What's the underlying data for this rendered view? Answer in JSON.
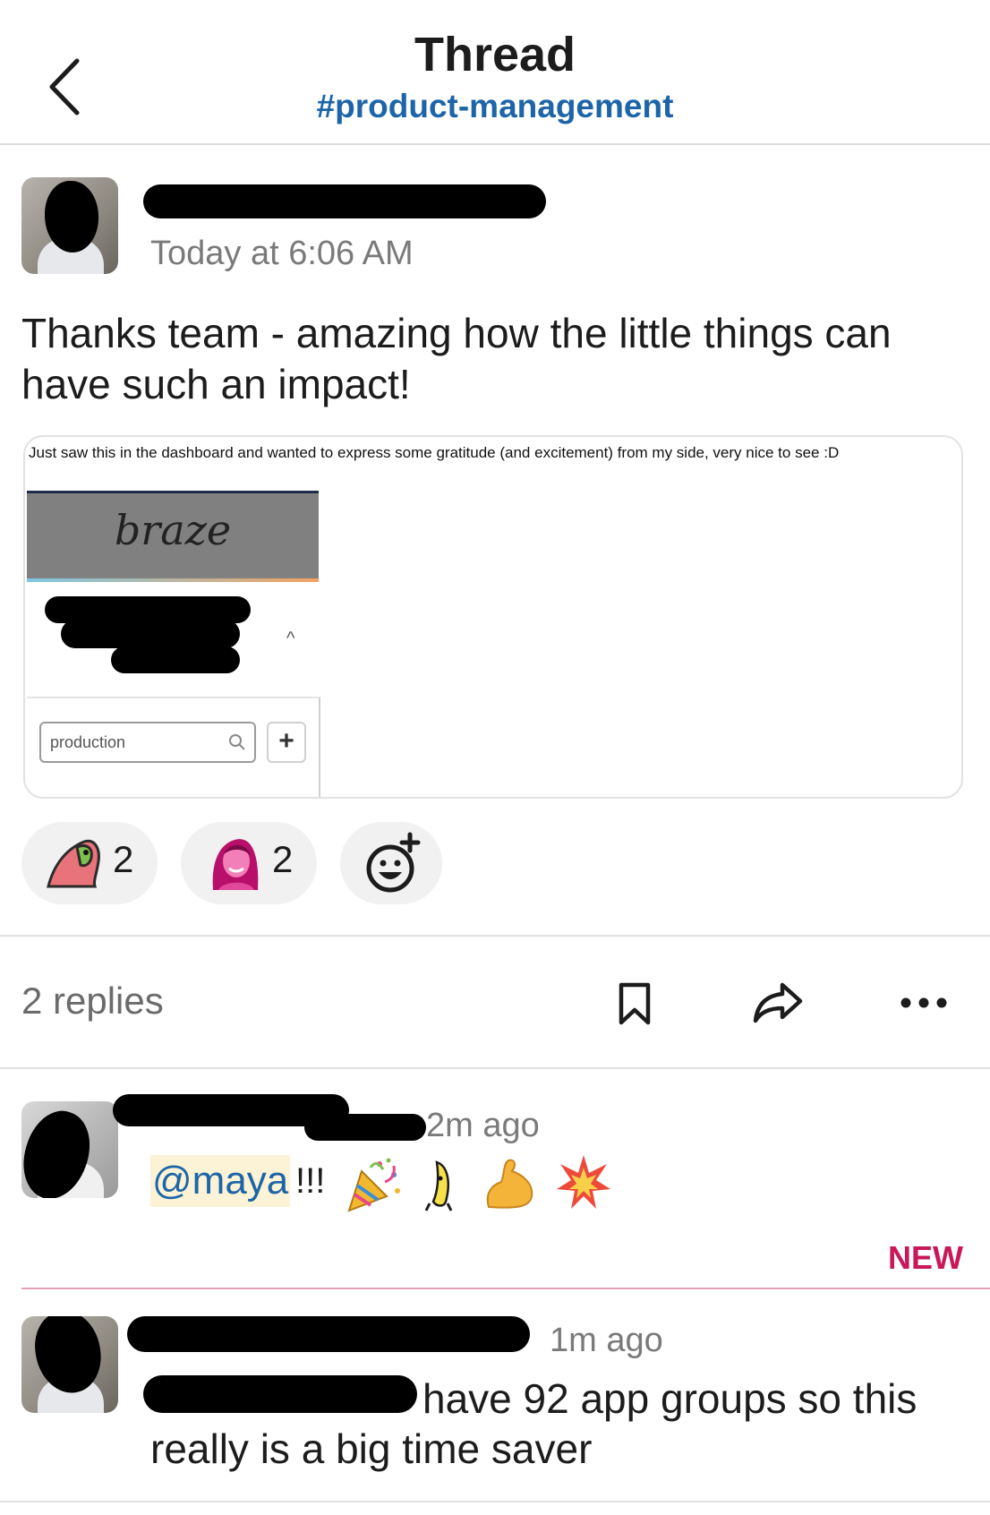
{
  "header": {
    "title": "Thread",
    "channel": "#product-management"
  },
  "parent_message": {
    "timestamp": "Today at 6:06 AM",
    "text": "Thanks team - amazing how the little things can have such an impact!",
    "attachment": {
      "caption": "Just saw this in the dashboard and wanted to express some gratitude (and excitement) from my side, very nice to see :D",
      "logo_text": "braze",
      "search_value": "production",
      "add_label": "+"
    },
    "reactions": [
      {
        "icon": "parrot-emoji",
        "count": "2"
      },
      {
        "icon": "person-emoji",
        "count": "2"
      },
      {
        "icon": "add-reaction-icon"
      }
    ]
  },
  "thread_bar": {
    "replies_label": "2 replies",
    "actions": [
      "bookmark-icon",
      "share-icon",
      "more-icon"
    ]
  },
  "replies": [
    {
      "timestamp": "2m ago",
      "mention": "@maya",
      "text": "!!!",
      "emojis": [
        "party-popper-emoji",
        "dancing-banana-emoji",
        "flexed-biceps-emoji",
        "collision-emoji"
      ]
    },
    {
      "timestamp": "1m ago",
      "text_line1": "have 92 app groups so this",
      "text_line2": "really is a big time saver"
    }
  ],
  "new_divider_label": "NEW",
  "colors": {
    "link": "#1d65a8",
    "new": "#c8185a",
    "mention_bg": "#fcf3d6"
  }
}
